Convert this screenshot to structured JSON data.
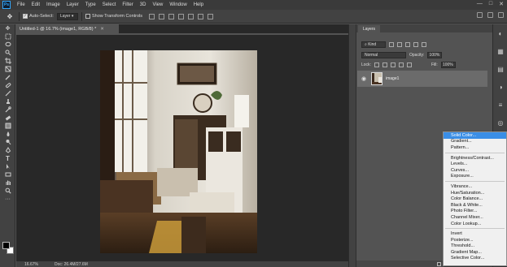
{
  "app": {
    "logo_text": "Ps"
  },
  "menubar": [
    "File",
    "Edit",
    "Image",
    "Layer",
    "Type",
    "Select",
    "Filter",
    "3D",
    "View",
    "Window",
    "Help"
  ],
  "window_controls": {
    "minimize": "—",
    "restore": "□",
    "close": "✕"
  },
  "options_bar": {
    "auto_select_label": "Auto-Select:",
    "auto_select_target": "Layer",
    "show_transform_label": "Show Transform Controls"
  },
  "document": {
    "tab_title": "Untitled-1 @ 16.7% (image1, RGB/8) *",
    "zoom": "16.67%",
    "doc_size": "Doc: 26.4M/27.6M"
  },
  "layers_panel": {
    "tab": "Layers",
    "kind_label": "Kind",
    "blend_mode": "Normal",
    "opacity_label": "Opacity:",
    "opacity_value": "100%",
    "lock_label": "Lock:",
    "fill_label": "Fill:",
    "fill_value": "100%",
    "layer_name": "image1"
  },
  "adjustment_menu": {
    "group1": [
      "Solid Color...",
      "Gradient...",
      "Pattern..."
    ],
    "group2": [
      "Brightness/Contrast...",
      "Levels...",
      "Curves...",
      "Exposure..."
    ],
    "group3": [
      "Vibrance...",
      "Hue/Saturation...",
      "Color Balance...",
      "Black & White...",
      "Photo Filter...",
      "Channel Mixer...",
      "Color Lookup..."
    ],
    "group4": [
      "Invert",
      "Posterize...",
      "Threshold...",
      "Gradient Map...",
      "Selective Color..."
    ],
    "highlighted": "Solid Color..."
  },
  "colors": {
    "accent": "#3a8ee6",
    "foreground": "#000000",
    "background": "#ffffff"
  }
}
